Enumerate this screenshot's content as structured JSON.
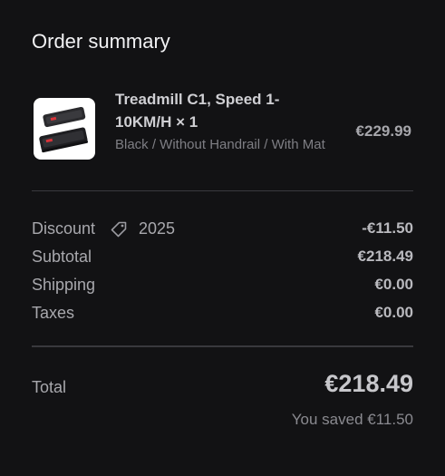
{
  "header": {
    "title": "Order summary"
  },
  "product": {
    "name": "Treadmill C1, Speed 1-10KM/H × 1",
    "variant": "Black / Without Handrail / With Mat",
    "price": "€229.99",
    "image_icon": "treadmill-image"
  },
  "summary": {
    "discount_label": "Discount",
    "discount_icon": "tag-icon",
    "discount_code": "2025",
    "discount_value": "-€11.50",
    "subtotal_label": "Subtotal",
    "subtotal_value": "€218.49",
    "shipping_label": "Shipping",
    "shipping_value": "€0.00",
    "taxes_label": "Taxes",
    "taxes_value": "€0.00"
  },
  "total": {
    "label": "Total",
    "value": "€218.49",
    "saved_text": "You saved €11.50"
  },
  "colors": {
    "background": "#121214",
    "text_primary": "#f2f2f4",
    "text_secondary": "#a8a8ad",
    "divider": "#3a3a3e",
    "accent": "#d9343a"
  }
}
